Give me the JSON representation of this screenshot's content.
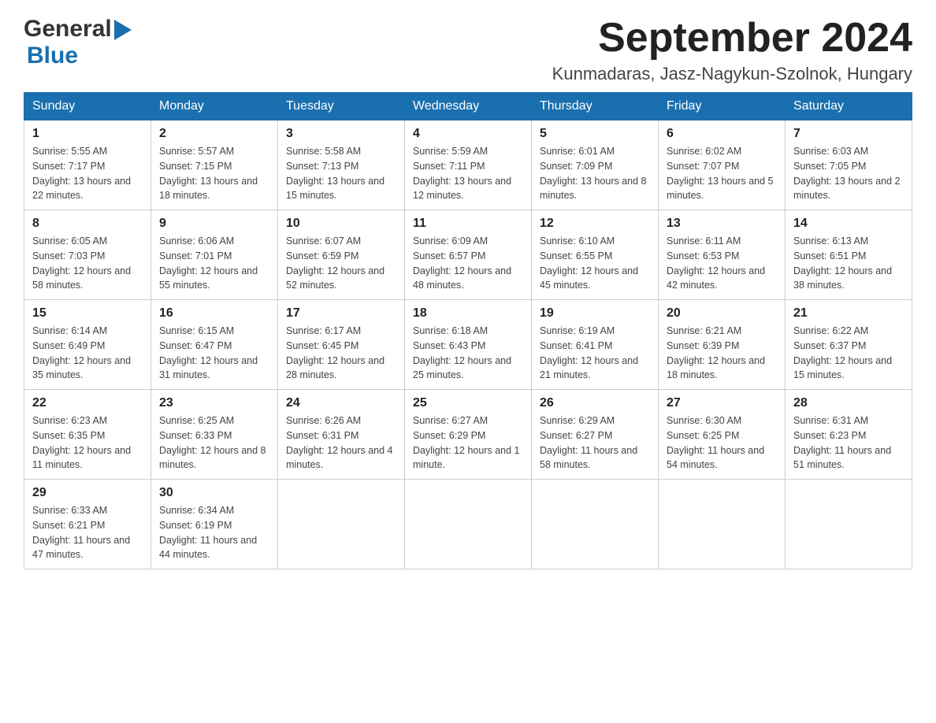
{
  "header": {
    "logo_general": "General",
    "logo_blue": "Blue",
    "month_title": "September 2024",
    "location": "Kunmadaras, Jasz-Nagykun-Szolnok, Hungary"
  },
  "weekdays": [
    "Sunday",
    "Monday",
    "Tuesday",
    "Wednesday",
    "Thursday",
    "Friday",
    "Saturday"
  ],
  "weeks": [
    [
      {
        "day": "1",
        "sunrise": "Sunrise: 5:55 AM",
        "sunset": "Sunset: 7:17 PM",
        "daylight": "Daylight: 13 hours and 22 minutes."
      },
      {
        "day": "2",
        "sunrise": "Sunrise: 5:57 AM",
        "sunset": "Sunset: 7:15 PM",
        "daylight": "Daylight: 13 hours and 18 minutes."
      },
      {
        "day": "3",
        "sunrise": "Sunrise: 5:58 AM",
        "sunset": "Sunset: 7:13 PM",
        "daylight": "Daylight: 13 hours and 15 minutes."
      },
      {
        "day": "4",
        "sunrise": "Sunrise: 5:59 AM",
        "sunset": "Sunset: 7:11 PM",
        "daylight": "Daylight: 13 hours and 12 minutes."
      },
      {
        "day": "5",
        "sunrise": "Sunrise: 6:01 AM",
        "sunset": "Sunset: 7:09 PM",
        "daylight": "Daylight: 13 hours and 8 minutes."
      },
      {
        "day": "6",
        "sunrise": "Sunrise: 6:02 AM",
        "sunset": "Sunset: 7:07 PM",
        "daylight": "Daylight: 13 hours and 5 minutes."
      },
      {
        "day": "7",
        "sunrise": "Sunrise: 6:03 AM",
        "sunset": "Sunset: 7:05 PM",
        "daylight": "Daylight: 13 hours and 2 minutes."
      }
    ],
    [
      {
        "day": "8",
        "sunrise": "Sunrise: 6:05 AM",
        "sunset": "Sunset: 7:03 PM",
        "daylight": "Daylight: 12 hours and 58 minutes."
      },
      {
        "day": "9",
        "sunrise": "Sunrise: 6:06 AM",
        "sunset": "Sunset: 7:01 PM",
        "daylight": "Daylight: 12 hours and 55 minutes."
      },
      {
        "day": "10",
        "sunrise": "Sunrise: 6:07 AM",
        "sunset": "Sunset: 6:59 PM",
        "daylight": "Daylight: 12 hours and 52 minutes."
      },
      {
        "day": "11",
        "sunrise": "Sunrise: 6:09 AM",
        "sunset": "Sunset: 6:57 PM",
        "daylight": "Daylight: 12 hours and 48 minutes."
      },
      {
        "day": "12",
        "sunrise": "Sunrise: 6:10 AM",
        "sunset": "Sunset: 6:55 PM",
        "daylight": "Daylight: 12 hours and 45 minutes."
      },
      {
        "day": "13",
        "sunrise": "Sunrise: 6:11 AM",
        "sunset": "Sunset: 6:53 PM",
        "daylight": "Daylight: 12 hours and 42 minutes."
      },
      {
        "day": "14",
        "sunrise": "Sunrise: 6:13 AM",
        "sunset": "Sunset: 6:51 PM",
        "daylight": "Daylight: 12 hours and 38 minutes."
      }
    ],
    [
      {
        "day": "15",
        "sunrise": "Sunrise: 6:14 AM",
        "sunset": "Sunset: 6:49 PM",
        "daylight": "Daylight: 12 hours and 35 minutes."
      },
      {
        "day": "16",
        "sunrise": "Sunrise: 6:15 AM",
        "sunset": "Sunset: 6:47 PM",
        "daylight": "Daylight: 12 hours and 31 minutes."
      },
      {
        "day": "17",
        "sunrise": "Sunrise: 6:17 AM",
        "sunset": "Sunset: 6:45 PM",
        "daylight": "Daylight: 12 hours and 28 minutes."
      },
      {
        "day": "18",
        "sunrise": "Sunrise: 6:18 AM",
        "sunset": "Sunset: 6:43 PM",
        "daylight": "Daylight: 12 hours and 25 minutes."
      },
      {
        "day": "19",
        "sunrise": "Sunrise: 6:19 AM",
        "sunset": "Sunset: 6:41 PM",
        "daylight": "Daylight: 12 hours and 21 minutes."
      },
      {
        "day": "20",
        "sunrise": "Sunrise: 6:21 AM",
        "sunset": "Sunset: 6:39 PM",
        "daylight": "Daylight: 12 hours and 18 minutes."
      },
      {
        "day": "21",
        "sunrise": "Sunrise: 6:22 AM",
        "sunset": "Sunset: 6:37 PM",
        "daylight": "Daylight: 12 hours and 15 minutes."
      }
    ],
    [
      {
        "day": "22",
        "sunrise": "Sunrise: 6:23 AM",
        "sunset": "Sunset: 6:35 PM",
        "daylight": "Daylight: 12 hours and 11 minutes."
      },
      {
        "day": "23",
        "sunrise": "Sunrise: 6:25 AM",
        "sunset": "Sunset: 6:33 PM",
        "daylight": "Daylight: 12 hours and 8 minutes."
      },
      {
        "day": "24",
        "sunrise": "Sunrise: 6:26 AM",
        "sunset": "Sunset: 6:31 PM",
        "daylight": "Daylight: 12 hours and 4 minutes."
      },
      {
        "day": "25",
        "sunrise": "Sunrise: 6:27 AM",
        "sunset": "Sunset: 6:29 PM",
        "daylight": "Daylight: 12 hours and 1 minute."
      },
      {
        "day": "26",
        "sunrise": "Sunrise: 6:29 AM",
        "sunset": "Sunset: 6:27 PM",
        "daylight": "Daylight: 11 hours and 58 minutes."
      },
      {
        "day": "27",
        "sunrise": "Sunrise: 6:30 AM",
        "sunset": "Sunset: 6:25 PM",
        "daylight": "Daylight: 11 hours and 54 minutes."
      },
      {
        "day": "28",
        "sunrise": "Sunrise: 6:31 AM",
        "sunset": "Sunset: 6:23 PM",
        "daylight": "Daylight: 11 hours and 51 minutes."
      }
    ],
    [
      {
        "day": "29",
        "sunrise": "Sunrise: 6:33 AM",
        "sunset": "Sunset: 6:21 PM",
        "daylight": "Daylight: 11 hours and 47 minutes."
      },
      {
        "day": "30",
        "sunrise": "Sunrise: 6:34 AM",
        "sunset": "Sunset: 6:19 PM",
        "daylight": "Daylight: 11 hours and 44 minutes."
      },
      null,
      null,
      null,
      null,
      null
    ]
  ]
}
